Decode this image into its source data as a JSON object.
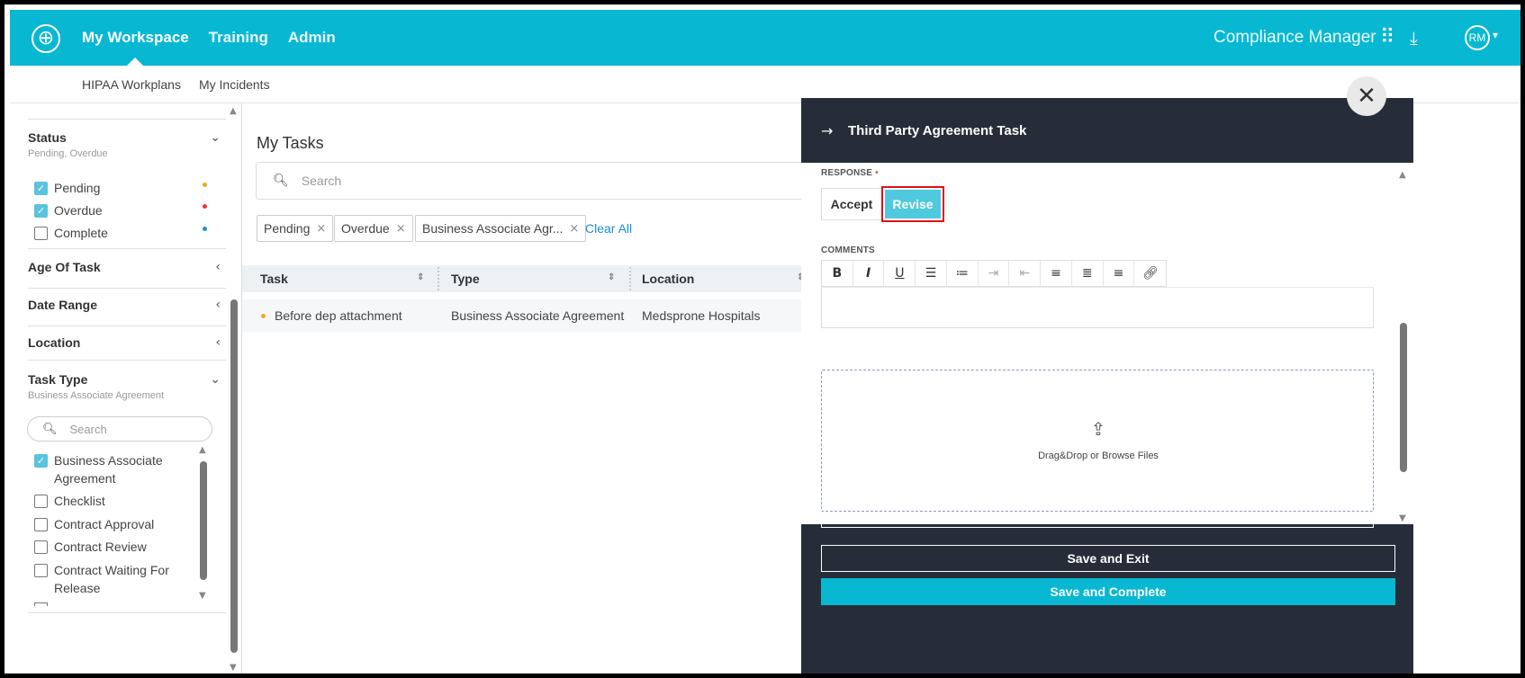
{
  "header": {
    "nav": [
      "My Workspace",
      "Training",
      "Admin"
    ],
    "brand": "Compliance Manager",
    "avatar_initials": "RM",
    "icons": [
      "grid-icon",
      "download-icon"
    ]
  },
  "subnav": [
    "HIPAA Workplans",
    "My Incidents"
  ],
  "sidebar": {
    "status": {
      "title": "Status",
      "summary": "Pending, Overdue",
      "options": [
        {
          "label": "Pending",
          "checked": true,
          "color": "#f0a81e"
        },
        {
          "label": "Overdue",
          "checked": true,
          "color": "#e23b2e"
        },
        {
          "label": "Complete",
          "checked": false,
          "color": "#1a8fd6"
        }
      ]
    },
    "sections": [
      "Age Of Task",
      "Date Range",
      "Location"
    ],
    "task_type": {
      "title": "Task Type",
      "summary": "Business Associate Agreement",
      "search_placeholder": "Search",
      "options": [
        {
          "label": "Business Associate Agreement",
          "checked": true
        },
        {
          "label": "Checklist",
          "checked": false
        },
        {
          "label": "Contract Approval",
          "checked": false
        },
        {
          "label": "Contract Review",
          "checked": false
        },
        {
          "label": "Contract Waiting For Release",
          "checked": false
        }
      ]
    }
  },
  "main": {
    "title": "My Tasks",
    "search_placeholder": "Search",
    "chips": [
      "Pending",
      "Overdue",
      "Business Associate Agr..."
    ],
    "clear_all": "Clear All",
    "columns": [
      "Task",
      "Type",
      "Location"
    ],
    "rows": [
      {
        "task": "Before dep attachment",
        "type": "Business Associate Agreement",
        "location": "Medsprone Hospitals",
        "status_color": "#f0a81e"
      }
    ]
  },
  "panel": {
    "title": "Third Party Agreement Task",
    "response_label": "RESPONSE",
    "accept_label": "Accept",
    "revise_label": "Revise",
    "comments_label": "COMMENTS",
    "toolbar": [
      "bold-icon",
      "italic-icon",
      "underline-icon",
      "bullet-list-icon",
      "numbered-list-icon",
      "indent-icon",
      "outdent-icon",
      "align-left-icon",
      "align-center-icon",
      "align-right-icon",
      "link-icon"
    ],
    "dropzone_text": "Drag&Drop or Browse Files",
    "save_exit_label": "Save and Exit",
    "save_complete_label": "Save and Complete"
  },
  "colors": {
    "primary": "#08b8d2",
    "panel_dark": "#272d38",
    "highlight_border": "#e0101a",
    "revise_bg": "#4fc9dd"
  }
}
